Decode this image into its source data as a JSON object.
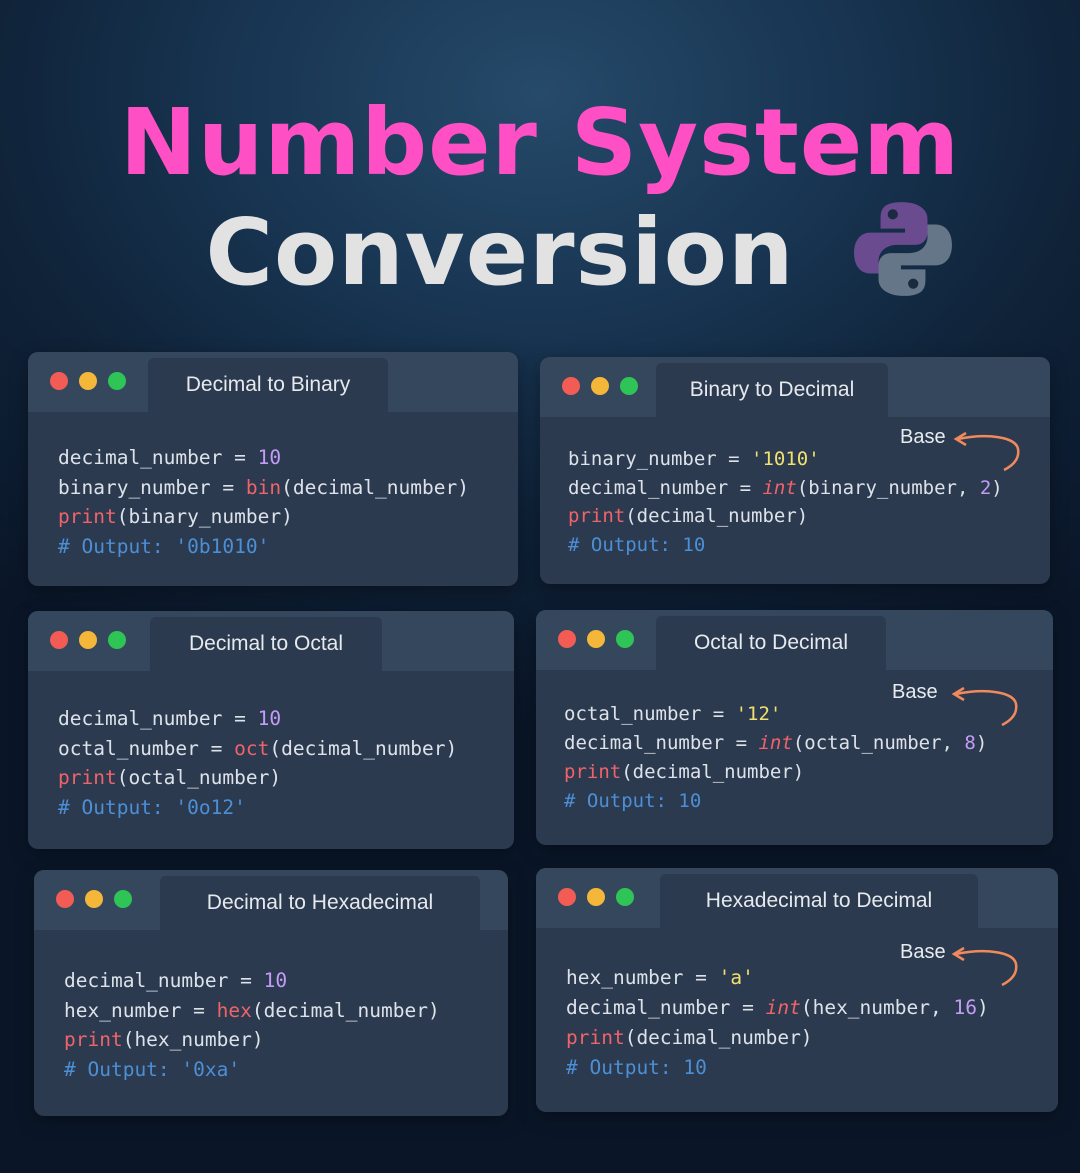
{
  "title": {
    "line1": "Number System",
    "line2": "Conversion"
  },
  "colors": {
    "title_pink": "#ff4fc4",
    "window_bg": "#2b3a4e",
    "function": "#f0636b",
    "number": "#c49cf7",
    "comment": "#4c8fd6",
    "arrow": "#f08a5d"
  },
  "logo": {
    "icon": "python-logo-icon"
  },
  "windows": [
    {
      "tab": "Decimal to Binary",
      "lines": [
        {
          "var": "decimal_number",
          "eq": " = ",
          "num": "10"
        },
        {
          "var": "binary_number",
          "eq": " = ",
          "fn": "bin",
          "args": "(decimal_number)"
        },
        {
          "fn": "print",
          "args": "(binary_number)"
        },
        {
          "comment": "# Output: '0b1010'"
        }
      ]
    },
    {
      "tab": "Binary to Decimal",
      "base": "Base",
      "lines": [
        {
          "var": "binary_number",
          "eq": " = ",
          "str": "'1010'"
        },
        {
          "var": "decimal_number",
          "eq": " = ",
          "fn": "int",
          "args": "(binary_number, ",
          "num": "2",
          "close": ")"
        },
        {
          "fn": "print",
          "args": "(decimal_number)"
        },
        {
          "comment": "# Output: 10"
        }
      ]
    },
    {
      "tab": "Decimal to Octal",
      "lines": [
        {
          "var": "decimal_number",
          "eq": " = ",
          "num": "10"
        },
        {
          "var": "octal_number",
          "eq": " = ",
          "fn": "oct",
          "args": "(decimal_number)"
        },
        {
          "fn": "print",
          "args": "(octal_number)"
        },
        {
          "comment": "# Output: '0o12'"
        }
      ]
    },
    {
      "tab": "Octal to Decimal",
      "base": "Base",
      "lines": [
        {
          "var": "octal_number",
          "eq": " = ",
          "str": "'12'"
        },
        {
          "var": "decimal_number",
          "eq": " = ",
          "fn": "int",
          "args": "(octal_number, ",
          "num": "8",
          "close": ")"
        },
        {
          "fn": "print",
          "args": "(decimal_number)"
        },
        {
          "comment": "# Output: 10"
        }
      ]
    },
    {
      "tab": "Decimal to Hexadecimal",
      "lines": [
        {
          "var": "decimal_number",
          "eq": " = ",
          "num": "10"
        },
        {
          "var": "hex_number",
          "eq": " = ",
          "fn": "hex",
          "args": "(decimal_number)"
        },
        {
          "fn": "print",
          "args": "(hex_number)"
        },
        {
          "comment": "# Output: '0xa'"
        }
      ]
    },
    {
      "tab": "Hexadecimal to Decimal",
      "base": "Base",
      "lines": [
        {
          "var": "hex_number",
          "eq": " = ",
          "str": "'a'"
        },
        {
          "var": "decimal_number",
          "eq": " = ",
          "fn": "int",
          "args": "(hex_number, ",
          "num": "16",
          "close": ")"
        },
        {
          "fn": "print",
          "args": "(decimal_number)"
        },
        {
          "comment": "# Output: 10"
        }
      ]
    }
  ]
}
